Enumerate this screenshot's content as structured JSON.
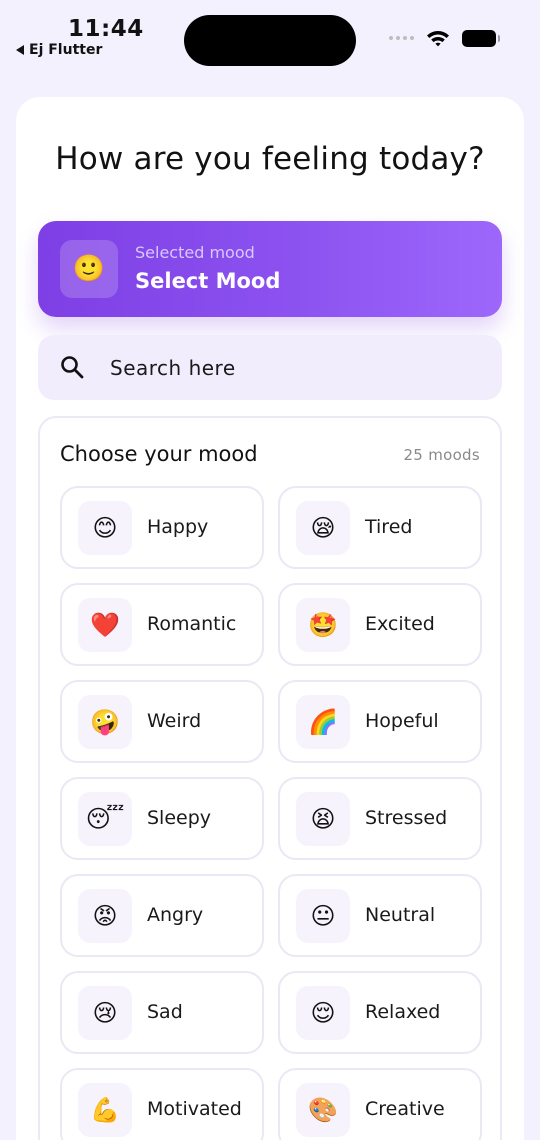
{
  "status_bar": {
    "time": "11:44",
    "back_app": "Ej Flutter"
  },
  "header": {
    "title": "How are you feeling today?"
  },
  "selected_mood": {
    "emoji": "🙂",
    "subtitle": "Selected mood",
    "title": "Select Mood"
  },
  "search": {
    "placeholder": "Search here",
    "value": ""
  },
  "mood_panel": {
    "title": "Choose your mood",
    "count": "25 moods",
    "moods": [
      {
        "emoji": "😊",
        "label": "Happy"
      },
      {
        "emoji": "😪",
        "label": "Tired"
      },
      {
        "emoji": "❤️",
        "label": "Romantic"
      },
      {
        "emoji": "🤩",
        "label": "Excited"
      },
      {
        "emoji": "🤪",
        "label": "Weird"
      },
      {
        "emoji": "🌈",
        "label": "Hopeful"
      },
      {
        "emoji": "😴",
        "label": "Sleepy"
      },
      {
        "emoji": "😫",
        "label": "Stressed"
      },
      {
        "emoji": "😡",
        "label": "Angry"
      },
      {
        "emoji": "😐",
        "label": "Neutral"
      },
      {
        "emoji": "😢",
        "label": "Sad"
      },
      {
        "emoji": "😌",
        "label": "Relaxed"
      },
      {
        "emoji": "💪",
        "label": "Motivated"
      },
      {
        "emoji": "🎨",
        "label": "Creative"
      }
    ]
  },
  "colors": {
    "accent": "#8c52f0",
    "background": "#f4f1fe",
    "search_bg": "#f1edfd"
  }
}
